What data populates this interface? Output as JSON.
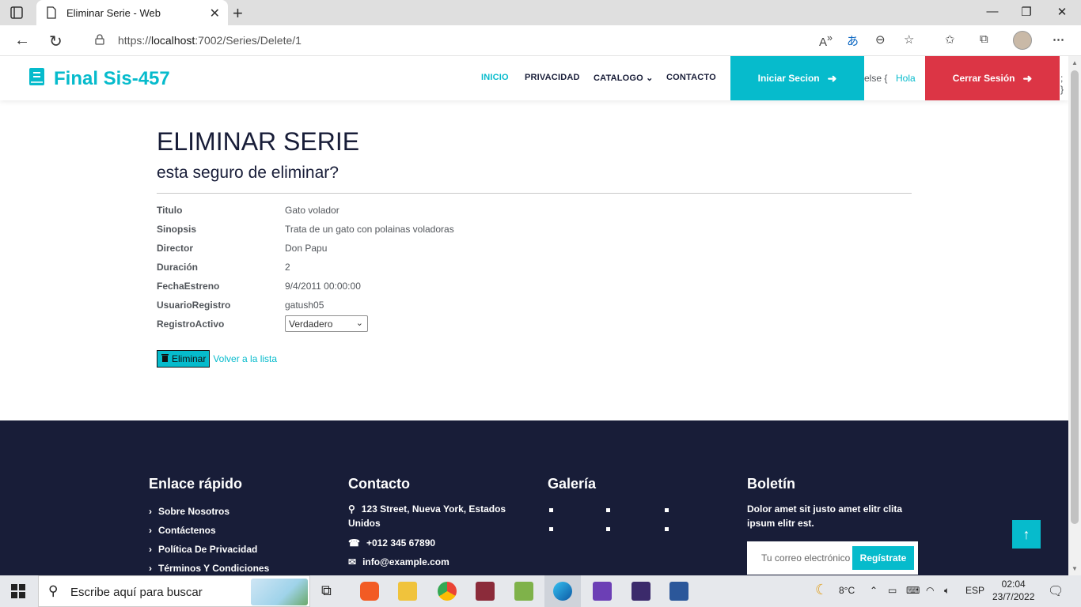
{
  "browser": {
    "tab_title": "Eliminar Serie - Web",
    "url_prefix": "https://",
    "url_host": "localhost",
    "url_rest": ":7002/Series/Delete/1"
  },
  "navbar": {
    "brand": "Final Sis-457",
    "links": [
      "INICIO",
      "PRIVACIDAD",
      "CATALOGO",
      "CONTACTO"
    ],
    "login_label": "Iniciar Secion",
    "leak_left": "else {",
    "greeting": "Hola",
    "logout_label": "Cerrar Sesión",
    "leak_right": "; }"
  },
  "main": {
    "title": "ELIMINAR SERIE",
    "subtitle": "esta seguro de eliminar?",
    "fields": [
      {
        "label": "Titulo",
        "value": "Gato volador"
      },
      {
        "label": "Sinopsis",
        "value": "Trata de un gato con polainas voladoras"
      },
      {
        "label": "Director",
        "value": "Don Papu"
      },
      {
        "label": "Duración",
        "value": "2"
      },
      {
        "label": "FechaEstreno",
        "value": "9/4/2011 00:00:00"
      },
      {
        "label": "UsuarioRegistro",
        "value": "gatush05"
      }
    ],
    "registro_activo_label": "RegistroActivo",
    "registro_activo_value": "Verdadero",
    "delete_label": "Eliminar",
    "back_label": "Volver a la lista"
  },
  "footer": {
    "quick_links_title": "Enlace rápido",
    "quick_links": [
      "Sobre Nosotros",
      "Contáctenos",
      "Política De Privacidad",
      "Términos Y Condiciones"
    ],
    "contact_title": "Contacto",
    "address": "123 Street, Nueva York, Estados Unidos",
    "phone": "+012 345 67890",
    "email": "info@example.com",
    "gallery_title": "Galería",
    "newsletter_title": "Boletín",
    "newsletter_text": "Dolor amet sit justo amet elitr clita ipsum elitr est.",
    "newsletter_placeholder": "Tu correo electrónico",
    "newsletter_button": "Regístrate"
  },
  "taskbar": {
    "search_placeholder": "Escribe aquí para buscar",
    "temperature": "8°C",
    "language": "ESP",
    "time": "02:04",
    "date": "23/7/2022"
  },
  "colors": {
    "accent": "#06bbcc",
    "danger": "#dc3545",
    "dark": "#181d38"
  }
}
